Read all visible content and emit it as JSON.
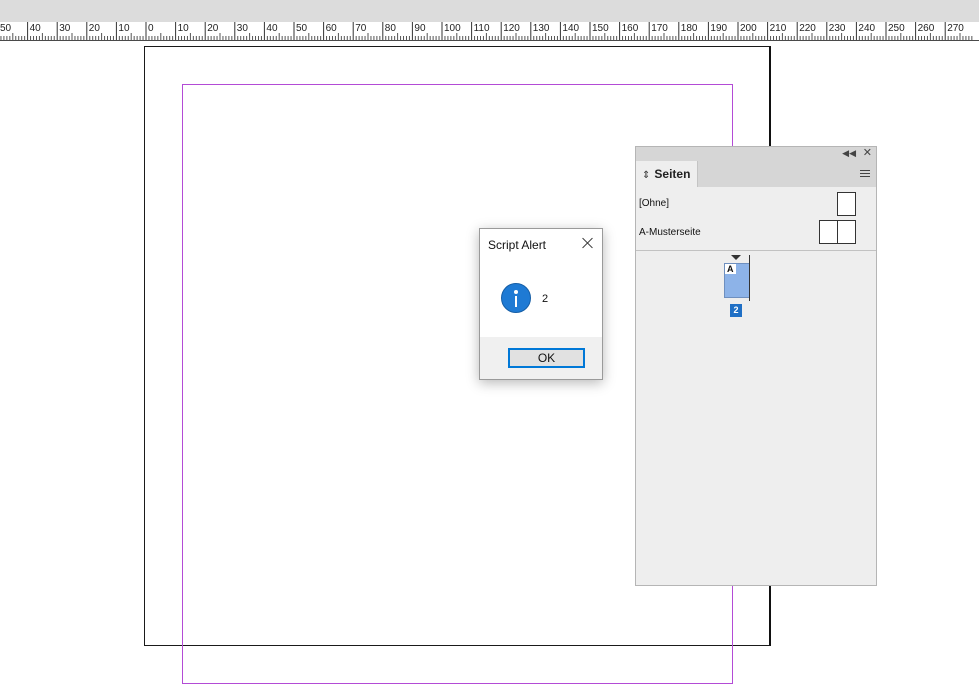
{
  "ruler": {
    "labels": [
      "50",
      "40",
      "30",
      "20",
      "10",
      "0",
      "10",
      "20",
      "30",
      "40",
      "50",
      "60",
      "70",
      "80",
      "90",
      "100",
      "110",
      "120",
      "130",
      "140",
      "150",
      "160",
      "170",
      "180",
      "190",
      "200",
      "210",
      "220",
      "230",
      "240",
      "250",
      "260",
      "270"
    ]
  },
  "pages_panel": {
    "collapse_icon": "double-chevron-left-icon",
    "close_icon": "close-icon",
    "tab_icon": "up-down-chevron-icon",
    "tab_label": "Seiten",
    "menu_icon": "panel-menu-icon",
    "masters": [
      {
        "label": "[Ohne]"
      },
      {
        "label": "A-Musterseite"
      }
    ],
    "document_page": {
      "master_prefix": "A",
      "number": "2"
    }
  },
  "dialog": {
    "title": "Script Alert",
    "icon": "info-icon",
    "message": "2",
    "ok_label": "OK"
  },
  "colors": {
    "margin_guide": "#b34bd6",
    "page_selected": "#8db3e8",
    "page_number_badge": "#1f6fc5",
    "info_icon": "#1e7ad4",
    "button_focus": "#0078d7"
  }
}
